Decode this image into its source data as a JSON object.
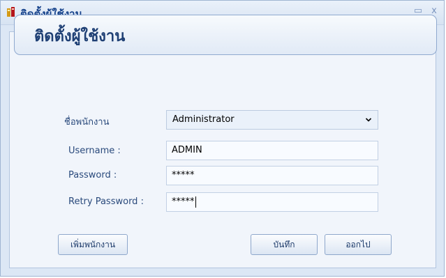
{
  "window": {
    "title": "ติดตั้งผู้ใช้งาน",
    "controls": {
      "minimize": "_",
      "maximize": "▭",
      "close": "x"
    }
  },
  "header": {
    "title": "ติดตั้งผู้ใช้งาน"
  },
  "form": {
    "employee_label": "ชื่อพนักงาน",
    "employee_value": "Administrator",
    "username_label": "Username :",
    "username_value": "ADMIN",
    "password_label": "Password :",
    "password_value": "*****",
    "retry_label": "Retry Password :",
    "retry_value": "*****"
  },
  "buttons": {
    "add_employee": "เพิ่มพนักงาน",
    "save": "บันทึก",
    "exit": "ออกไป"
  },
  "icons": {
    "app": "app-icon",
    "dropdown": "chevron-down-icon"
  },
  "colors": {
    "title_text": "#15428b",
    "label_text": "#2a4a7c",
    "window_bg": "#dce7f5"
  }
}
